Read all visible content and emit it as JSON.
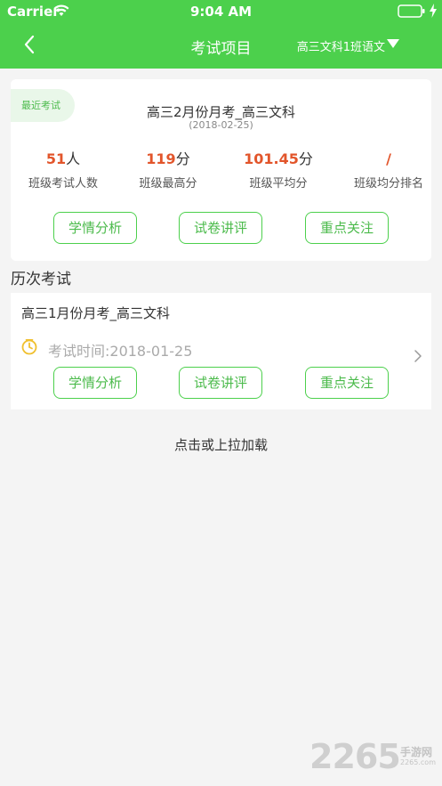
{
  "status_bar": {
    "carrier": "Carrier",
    "time": "9:04 AM"
  },
  "nav": {
    "title": "考试项目",
    "class_selector": "高三文科1班语文"
  },
  "latest_exam": {
    "tag": "最近考试",
    "title": "高三2月份月考_高三文科",
    "date": "(2018-02-25)",
    "stats": [
      {
        "value": "51",
        "unit": "人",
        "label": "班级考试人数"
      },
      {
        "value": "119",
        "unit": "分",
        "label": "班级最高分"
      },
      {
        "value": "101.45",
        "unit": "分",
        "label": "班级平均分"
      },
      {
        "value": "/",
        "unit": "",
        "label": "班级均分排名"
      }
    ],
    "actions": [
      "学情分析",
      "试卷讲评",
      "重点关注"
    ]
  },
  "history": {
    "section_title": "历次考试",
    "items": [
      {
        "title": "高三1月份月考_高三文科",
        "time": "考试时间:2018-01-25",
        "actions": [
          "学情分析",
          "试卷讲评",
          "重点关注"
        ]
      }
    ]
  },
  "load_more": "点击或上拉加载",
  "watermark": {
    "main": "2265",
    "sub": "手游网",
    "url": "2265.com"
  },
  "colors": {
    "brand_green": "#4cd04c",
    "accent_orange": "#e2552b",
    "tag_bg": "#e9f7e9"
  }
}
